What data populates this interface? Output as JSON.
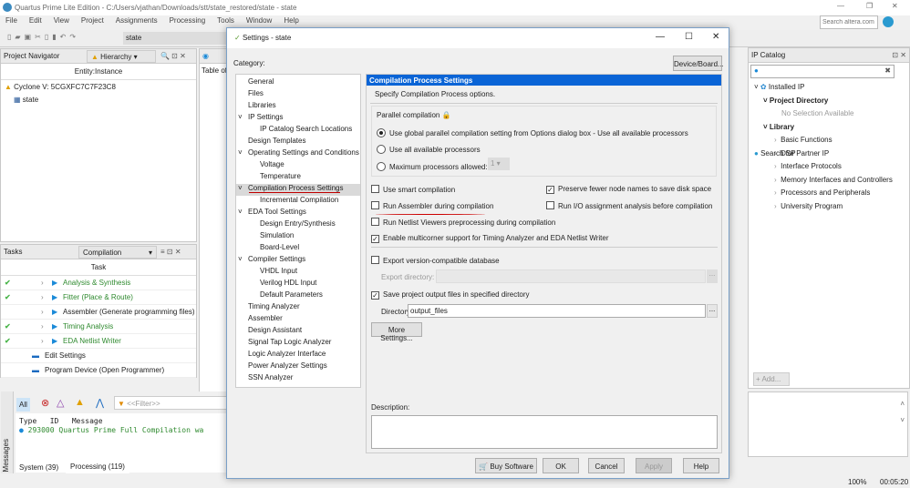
{
  "window": {
    "title": "Quartus Prime Lite Edition - C:/Users/vjathan/Downloads/stt/state_restored/state - state",
    "search_placeholder": "Search altera.com"
  },
  "menu": [
    "File",
    "Edit",
    "View",
    "Project",
    "Assignments",
    "Processing",
    "Tools",
    "Window",
    "Help"
  ],
  "toolbar": {
    "project_combo": "state"
  },
  "project_navigator": {
    "title": "Project Navigator",
    "view": "Hierarchy",
    "column": "Entity:Instance",
    "device": "Cyclone V: 5CGXFC7C7F23C8",
    "entity": "state"
  },
  "middle_panel": {
    "title": "Table of"
  },
  "tasks": {
    "title": "Tasks",
    "flow": "Compilation",
    "column": "Task",
    "items": [
      {
        "label": "Analysis & Synthesis",
        "done": true
      },
      {
        "label": "Fitter (Place & Route)",
        "done": true
      },
      {
        "label": "Assembler (Generate programming files)",
        "done": false
      },
      {
        "label": "Timing Analysis",
        "done": true
      },
      {
        "label": "EDA Netlist Writer",
        "done": true
      },
      {
        "label": "Edit Settings",
        "done": false
      },
      {
        "label": "Program Device (Open Programmer)",
        "done": false
      }
    ]
  },
  "messages": {
    "side_label": "Messages",
    "all": "All",
    "filter_placeholder": "<<Filter>>",
    "columns": [
      "Type",
      "ID",
      "Message"
    ],
    "rows": [
      {
        "id": "293000",
        "message": "Quartus Prime Full Compilation wa"
      }
    ],
    "tabs": [
      "System (39)",
      "Processing (119)"
    ]
  },
  "dialog": {
    "title": "Settings - state",
    "category_label": "Category:",
    "device_board": "Device/Board...",
    "categories": [
      {
        "label": "General",
        "level": 0
      },
      {
        "label": "Files",
        "level": 0
      },
      {
        "label": "Libraries",
        "level": 0
      },
      {
        "label": "IP Settings",
        "level": -1
      },
      {
        "label": "IP Catalog Search Locations",
        "level": 1
      },
      {
        "label": "Design Templates",
        "level": 0
      },
      {
        "label": "Operating Settings and Conditions",
        "level": -1
      },
      {
        "label": "Voltage",
        "level": 1
      },
      {
        "label": "Temperature",
        "level": 1
      },
      {
        "label": "Compilation Process Settings",
        "level": -1,
        "selected": true
      },
      {
        "label": "Incremental Compilation",
        "level": 1
      },
      {
        "label": "EDA Tool Settings",
        "level": -1
      },
      {
        "label": "Design Entry/Synthesis",
        "level": 1
      },
      {
        "label": "Simulation",
        "level": 1
      },
      {
        "label": "Board-Level",
        "level": 1
      },
      {
        "label": "Compiler Settings",
        "level": -1
      },
      {
        "label": "VHDL Input",
        "level": 1
      },
      {
        "label": "Verilog HDL Input",
        "level": 1
      },
      {
        "label": "Default Parameters",
        "level": 1
      },
      {
        "label": "Timing Analyzer",
        "level": 0
      },
      {
        "label": "Assembler",
        "level": 0
      },
      {
        "label": "Design Assistant",
        "level": 0
      },
      {
        "label": "Signal Tap Logic Analyzer",
        "level": 0
      },
      {
        "label": "Logic Analyzer Interface",
        "level": 0
      },
      {
        "label": "Power Analyzer Settings",
        "level": 0
      },
      {
        "label": "SSN Analyzer",
        "level": 0
      }
    ],
    "page_title": "Compilation Process Settings",
    "page_desc": "Specify Compilation Process options.",
    "parallel": {
      "label": "Parallel compilation",
      "options": [
        "Use global parallel compilation setting from Options dialog box - Use all available processors",
        "Use all available processors",
        "Maximum processors allowed:"
      ],
      "selected": 0,
      "max_value": "1"
    },
    "checks": {
      "smart": {
        "label": "Use smart compilation",
        "checked": false
      },
      "preserve": {
        "label": "Preserve fewer node names to save disk space",
        "checked": true
      },
      "assembler": {
        "label": "Run Assembler during compilation",
        "checked": false
      },
      "io": {
        "label": "Run I/O assignment analysis before compilation",
        "checked": false
      },
      "netlist": {
        "label": "Run Netlist Viewers preprocessing during compilation",
        "checked": false
      },
      "multicorner": {
        "label": "Enable multicorner support for Timing Analyzer and EDA Netlist Writer",
        "checked": true
      },
      "export": {
        "label": "Export version-compatible database",
        "checked": false
      },
      "save_output": {
        "label": "Save project output files in specified directory",
        "checked": true
      }
    },
    "export_dir_label": "Export directory:",
    "dir_name_label": "Directory name:",
    "dir_name_value": "output_files",
    "browse": "...",
    "more_settings": "More Settings...",
    "description_label": "Description:",
    "buttons": {
      "buy": "Buy Software",
      "ok": "OK",
      "cancel": "Cancel",
      "apply": "Apply",
      "help": "Help"
    }
  },
  "ip_catalog": {
    "title": "IP Catalog",
    "installed": "Installed IP",
    "project_dir": "Project Directory",
    "no_selection": "No Selection Available",
    "library": "Library",
    "items": [
      "Basic Functions",
      "DSP",
      "Interface Protocols",
      "Memory Interfaces and Controllers",
      "Processors and Peripherals",
      "University Program"
    ],
    "partner": "Search for Partner IP",
    "add": "Add..."
  },
  "status": {
    "zoom": "100%",
    "time": "00:05:20"
  },
  "colors": {
    "accent": "#0a64d6",
    "selected_bg": "#d9d9d9",
    "annotation": "#c00000"
  }
}
